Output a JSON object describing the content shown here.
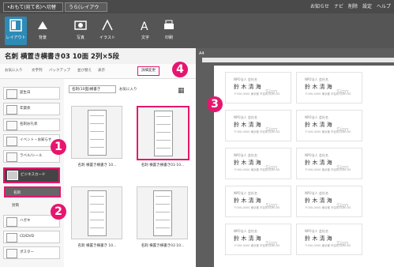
{
  "window": {
    "tabs": [
      "•おもて(宛て名)へ切替",
      "うら(レイアウト)"
    ],
    "right_items": [
      "お知らせ",
      "ナビ",
      "削除",
      "設定",
      "ヘルプ"
    ]
  },
  "toolbar": {
    "buttons": [
      {
        "label": "レイアウト",
        "icon": "layout-icon"
      },
      {
        "label": "背景",
        "icon": "background-icon"
      },
      {
        "label": "写真",
        "icon": "photo-icon"
      },
      {
        "label": "イラスト",
        "icon": "illustration-icon"
      },
      {
        "label": "文字",
        "icon": "text-icon"
      },
      {
        "label": "印刷",
        "icon": "print-icon"
      }
    ]
  },
  "header": {
    "title": "名刺  横置き横書き03  10面 2列×5段"
  },
  "filter": {
    "items": [
      "お気に入り",
      "文字列",
      "バックアップ",
      "並び替え",
      "表示"
    ],
    "detail_button": "詳細変更"
  },
  "sidebar": {
    "items": [
      "誕生日",
      "年賀状",
      "名刺お礼状",
      "イベント・お知らせ",
      "ラベル/シール",
      "ビジネスカード"
    ],
    "subitems": [
      "名刺",
      "封筒"
    ],
    "more": [
      "ハガキ",
      "CD/DVD",
      "ポスター"
    ]
  },
  "content": {
    "dropdown": "名刺(10面)横書き",
    "favorite": "お気に入り",
    "cards": [
      "名刺  横置き横書き 10...",
      "名刺  横置き横書き03 10...",
      "名刺  横置き横書き 10...",
      "名刺  横置き横書き03 10..."
    ]
  },
  "preview": {
    "paper_label": "A4",
    "card": {
      "company": "NPO法人 会社名",
      "name": "鈴 木  清 海",
      "address": "〒000-0000 東京都 市区町村 00-00",
      "sig": "Sign"
    }
  },
  "annotations": [
    "1",
    "2",
    "3",
    "4"
  ],
  "accent_color": "#e6166e"
}
